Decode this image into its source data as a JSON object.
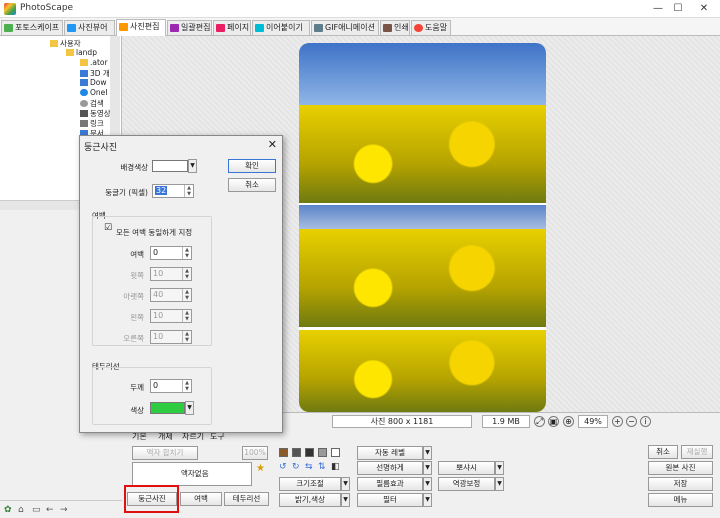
{
  "window": {
    "title": "PhotoScape",
    "min": "—",
    "max": "☐",
    "close": "✕"
  },
  "tabs": [
    {
      "label": "포토스케이프",
      "color": "#4caf50"
    },
    {
      "label": "사진뷰어",
      "color": "#2196f3"
    },
    {
      "label": "사진편집",
      "color": "#ff9800"
    },
    {
      "label": "일괄편집",
      "color": "#9c27b0"
    },
    {
      "label": "페이지",
      "color": "#e91e63"
    },
    {
      "label": "이어붙이기",
      "color": "#00bcd4"
    },
    {
      "label": "GIF애니메이션",
      "color": "#607d8b"
    },
    {
      "label": "인쇄",
      "color": "#795548"
    },
    {
      "label": "도움말",
      "color": "#f44336"
    }
  ],
  "tree": [
    {
      "label": "사용자",
      "color": "#f4c542"
    },
    {
      "label": "landp",
      "color": "#f4c542"
    },
    {
      "label": ".ator",
      "color": "#f4c542"
    },
    {
      "label": "3D 개",
      "color": "#3a7bd5"
    },
    {
      "label": "Dow",
      "color": "#3a7bd5"
    },
    {
      "label": "OneI",
      "color": "#1e88e5"
    },
    {
      "label": "검색",
      "color": "#999999"
    },
    {
      "label": "동영상",
      "color": "#555555"
    },
    {
      "label": "링크",
      "color": "#777777"
    },
    {
      "label": "문서",
      "color": "#3a7bd5"
    }
  ],
  "status": {
    "photo_size": "사진 800 x 1181",
    "file_size": "1.9 MB",
    "zoom": "49%"
  },
  "bottom": {
    "subtabs": [
      "기본",
      "개체",
      "자르기",
      "도구"
    ],
    "frame_btn": "액자 합치기",
    "frame_pct": "100%",
    "frame_select": "액자없음",
    "btn_round": "둥근사진",
    "btn_margin": "여백",
    "btn_border": "테두리선",
    "btn_auto_level": "자동 레벨",
    "btn_resize": "크기조절",
    "btn_bright": "밝기,색상",
    "btn_sharpen": "선명하게",
    "btn_filmeffect": "필름효과",
    "btn_filter": "필터",
    "btn_backlight": "뽀샤시",
    "btn_backlight_fix": "역광보정",
    "btn_undo": "취소",
    "btn_redo": "재실행",
    "btn_original": "원본 사진",
    "btn_save": "저장",
    "btn_menu": "메뉴"
  },
  "dialog": {
    "title": "둥근사진",
    "bg_label": "배경색상",
    "round_label": "둥글기 (픽셀)",
    "round_value": "32",
    "ok": "확인",
    "cancel": "취소",
    "margin_group": "여백",
    "equal_label": "모든 여백 동일하게 지정",
    "equal_check": "☑",
    "margin_label": "여백",
    "margin_value": "0",
    "top_label": "윗쪽",
    "top_value": "10",
    "bottom_label": "아랫쪽",
    "bottom_value": "40",
    "left_label": "왼쪽",
    "left_value": "10",
    "right_label": "오른쪽",
    "right_value": "10",
    "border_group": "테두리선",
    "thickness_label": "두께",
    "thickness_value": "0",
    "color_label": "색상",
    "bg_color": "#ffffff",
    "border_color": "#2ecc40"
  }
}
